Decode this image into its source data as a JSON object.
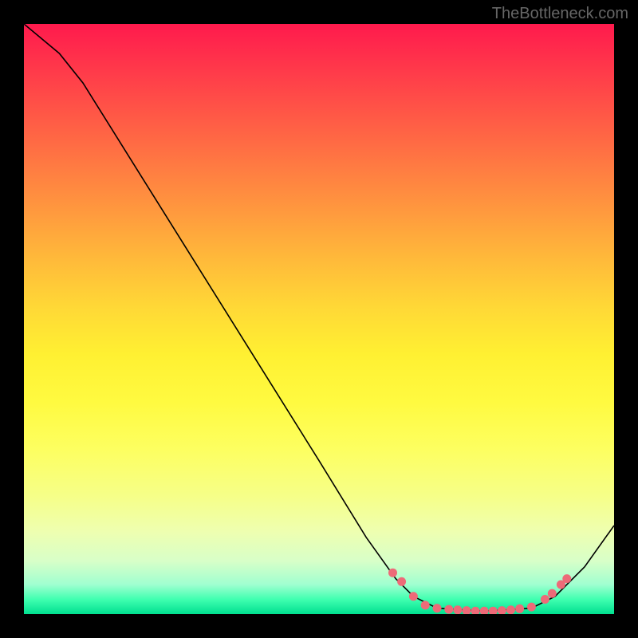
{
  "attribution": "TheBottleneck.com",
  "chart_data": {
    "type": "line",
    "title": "",
    "xlabel": "",
    "ylabel": "",
    "xlim": [
      0,
      1
    ],
    "ylim": [
      0,
      1
    ],
    "curve_points": [
      {
        "x": 0.0,
        "y": 1.0
      },
      {
        "x": 0.06,
        "y": 0.95
      },
      {
        "x": 0.1,
        "y": 0.9
      },
      {
        "x": 0.2,
        "y": 0.74
      },
      {
        "x": 0.3,
        "y": 0.58
      },
      {
        "x": 0.4,
        "y": 0.42
      },
      {
        "x": 0.5,
        "y": 0.26
      },
      {
        "x": 0.58,
        "y": 0.13
      },
      {
        "x": 0.63,
        "y": 0.06
      },
      {
        "x": 0.66,
        "y": 0.03
      },
      {
        "x": 0.7,
        "y": 0.01
      },
      {
        "x": 0.78,
        "y": 0.005
      },
      {
        "x": 0.86,
        "y": 0.01
      },
      {
        "x": 0.9,
        "y": 0.03
      },
      {
        "x": 0.95,
        "y": 0.08
      },
      {
        "x": 1.0,
        "y": 0.15
      }
    ],
    "markers": [
      {
        "x": 0.625,
        "y": 0.07
      },
      {
        "x": 0.64,
        "y": 0.055
      },
      {
        "x": 0.66,
        "y": 0.03
      },
      {
        "x": 0.68,
        "y": 0.015
      },
      {
        "x": 0.7,
        "y": 0.01
      },
      {
        "x": 0.72,
        "y": 0.008
      },
      {
        "x": 0.735,
        "y": 0.007
      },
      {
        "x": 0.75,
        "y": 0.006
      },
      {
        "x": 0.765,
        "y": 0.005
      },
      {
        "x": 0.78,
        "y": 0.005
      },
      {
        "x": 0.795,
        "y": 0.005
      },
      {
        "x": 0.81,
        "y": 0.006
      },
      {
        "x": 0.825,
        "y": 0.007
      },
      {
        "x": 0.84,
        "y": 0.009
      },
      {
        "x": 0.86,
        "y": 0.012
      },
      {
        "x": 0.883,
        "y": 0.025
      },
      {
        "x": 0.895,
        "y": 0.035
      },
      {
        "x": 0.91,
        "y": 0.05
      },
      {
        "x": 0.92,
        "y": 0.06
      }
    ],
    "marker_color": "#ed6a78",
    "curve_color": "#000000"
  }
}
